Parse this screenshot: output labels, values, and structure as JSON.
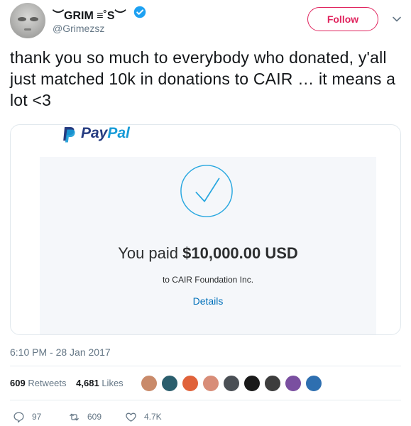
{
  "user": {
    "display_name": "︶GRIM ≡˚S︶",
    "handle": "@Grimezsz",
    "verified_badge_icon": "verified-check-icon"
  },
  "header": {
    "follow_label": "Follow",
    "menu_icon": "chevron-down-icon"
  },
  "tweet": {
    "text": "thank you so much to everybody who donated, y'all just matched 10k in donations to CAIR … it means a lot <3",
    "timestamp": "6:10 PM - 28 Jan 2017"
  },
  "card": {
    "brand_pay": "Pay",
    "brand_pal": "Pal",
    "paid_prefix": "You paid ",
    "amount": "$10,000.00 USD",
    "recipient": "to CAIR Foundation Inc.",
    "details_label": "Details",
    "colors": {
      "pay": "#253b80",
      "pal": "#179bd7",
      "check": "#29a8e0"
    }
  },
  "stats": {
    "retweets_count": "609",
    "retweets_label": "Retweets",
    "likes_count": "4,681",
    "likes_label": "Likes",
    "liker_avatars": [
      {
        "color": "#c98a6a"
      },
      {
        "color": "#2b5e6d"
      },
      {
        "color": "#e0623a"
      },
      {
        "color": "#d88d78"
      },
      {
        "color": "#4a4f55"
      },
      {
        "color": "#1a1a1a"
      },
      {
        "color": "#3d3d3d"
      },
      {
        "color": "#7a4fa0"
      },
      {
        "color": "#2e6fb0"
      }
    ]
  },
  "actions": {
    "reply_count": "97",
    "retweet_count": "609",
    "like_count": "4.7K"
  },
  "theme": {
    "accent": "#e0245e",
    "verified": "#1da1f2",
    "muted": "#657786"
  }
}
